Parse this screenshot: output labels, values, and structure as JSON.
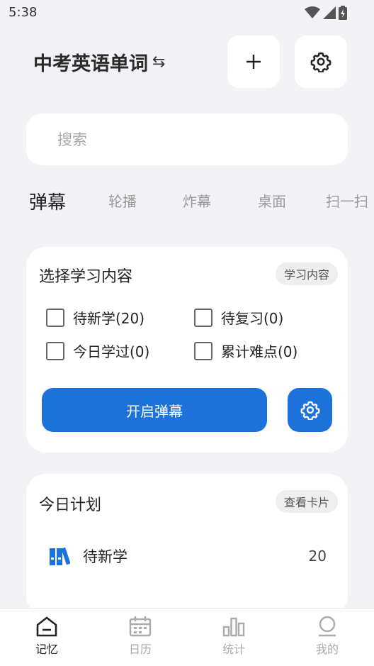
{
  "status": {
    "time": "5:38"
  },
  "header": {
    "title": "中考英语单词",
    "swap_icon": "⇆"
  },
  "search": {
    "placeholder": "搜索",
    "value": ""
  },
  "tabs": [
    {
      "label": "弹幕",
      "active": true
    },
    {
      "label": "轮播",
      "active": false
    },
    {
      "label": "炸幕",
      "active": false
    },
    {
      "label": "桌面",
      "active": false
    },
    {
      "label": "扫一扫",
      "active": false
    }
  ],
  "select_card": {
    "title": "选择学习内容",
    "pill": "学习内容",
    "options": [
      {
        "label": "待新学(20)",
        "checked": false
      },
      {
        "label": "待复习(0)",
        "checked": false
      },
      {
        "label": "今日学过(0)",
        "checked": false
      },
      {
        "label": "累计难点(0)",
        "checked": false
      }
    ],
    "start_button": "开启弹幕"
  },
  "plan_card": {
    "title": "今日计划",
    "pill": "查看卡片",
    "rows": [
      {
        "label": "待新学",
        "count": "20"
      }
    ]
  },
  "nav": [
    {
      "label": "记忆",
      "icon": "home-icon",
      "active": true
    },
    {
      "label": "日历",
      "icon": "calendar-icon",
      "active": false
    },
    {
      "label": "统计",
      "icon": "bar-chart-icon",
      "active": false
    },
    {
      "label": "我的",
      "icon": "profile-icon",
      "active": false
    }
  ],
  "colors": {
    "accent": "#1c72d8",
    "background": "#f3f2f7"
  }
}
